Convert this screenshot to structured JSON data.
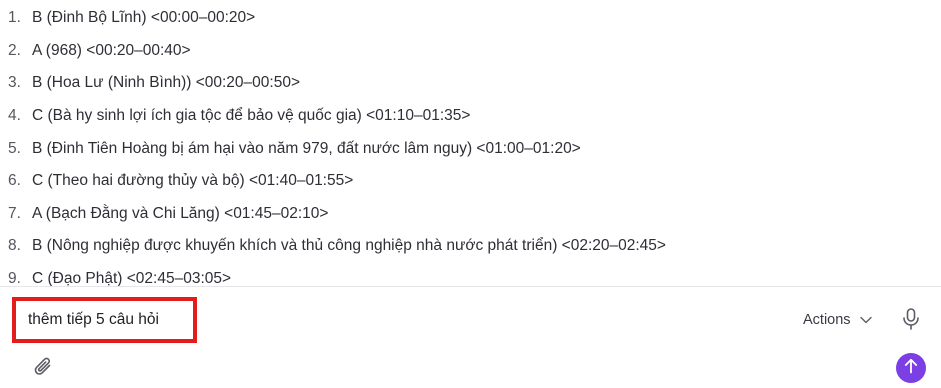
{
  "answers": [
    {
      "num": "1.",
      "text": "B (Đinh Bộ Lĩnh) <00:00–00:20>"
    },
    {
      "num": "2.",
      "text": "A (968) <00:20–00:40>"
    },
    {
      "num": "3.",
      "text": "B (Hoa Lư (Ninh Bình)) <00:20–00:50>"
    },
    {
      "num": "4.",
      "text": "C (Bà hy sinh lợi ích gia tộc để bảo vệ quốc gia) <01:10–01:35>"
    },
    {
      "num": "5.",
      "text": "B (Đinh Tiên Hoàng bị ám hại vào năm 979, đất nước lâm nguy) <01:00–01:20>"
    },
    {
      "num": "6.",
      "text": "C (Theo hai đường thủy và bộ) <01:40–01:55>"
    },
    {
      "num": "7.",
      "text": "A (Bạch Đằng và Chi Lăng) <01:45–02:10>"
    },
    {
      "num": "8.",
      "text": "B (Nông nghiệp được khuyến khích và thủ công nghiệp nhà nước phát triển) <02:20–02:45>"
    },
    {
      "num": "9.",
      "text": "C (Đạo Phật) <02:45–03:05>"
    }
  ],
  "composer": {
    "input_value": "thêm tiếp 5 câu hỏi",
    "actions_label": "Actions",
    "icons": {
      "actions_chevron": "chevron-down-icon",
      "mic": "microphone-icon",
      "attach": "paperclip-icon",
      "send": "arrow-up-icon"
    }
  },
  "colors": {
    "highlight_border": "#e31c1c",
    "send_button": "#7b3fe4",
    "text": "#2e2e36",
    "icon_gray": "#5b5c66"
  }
}
